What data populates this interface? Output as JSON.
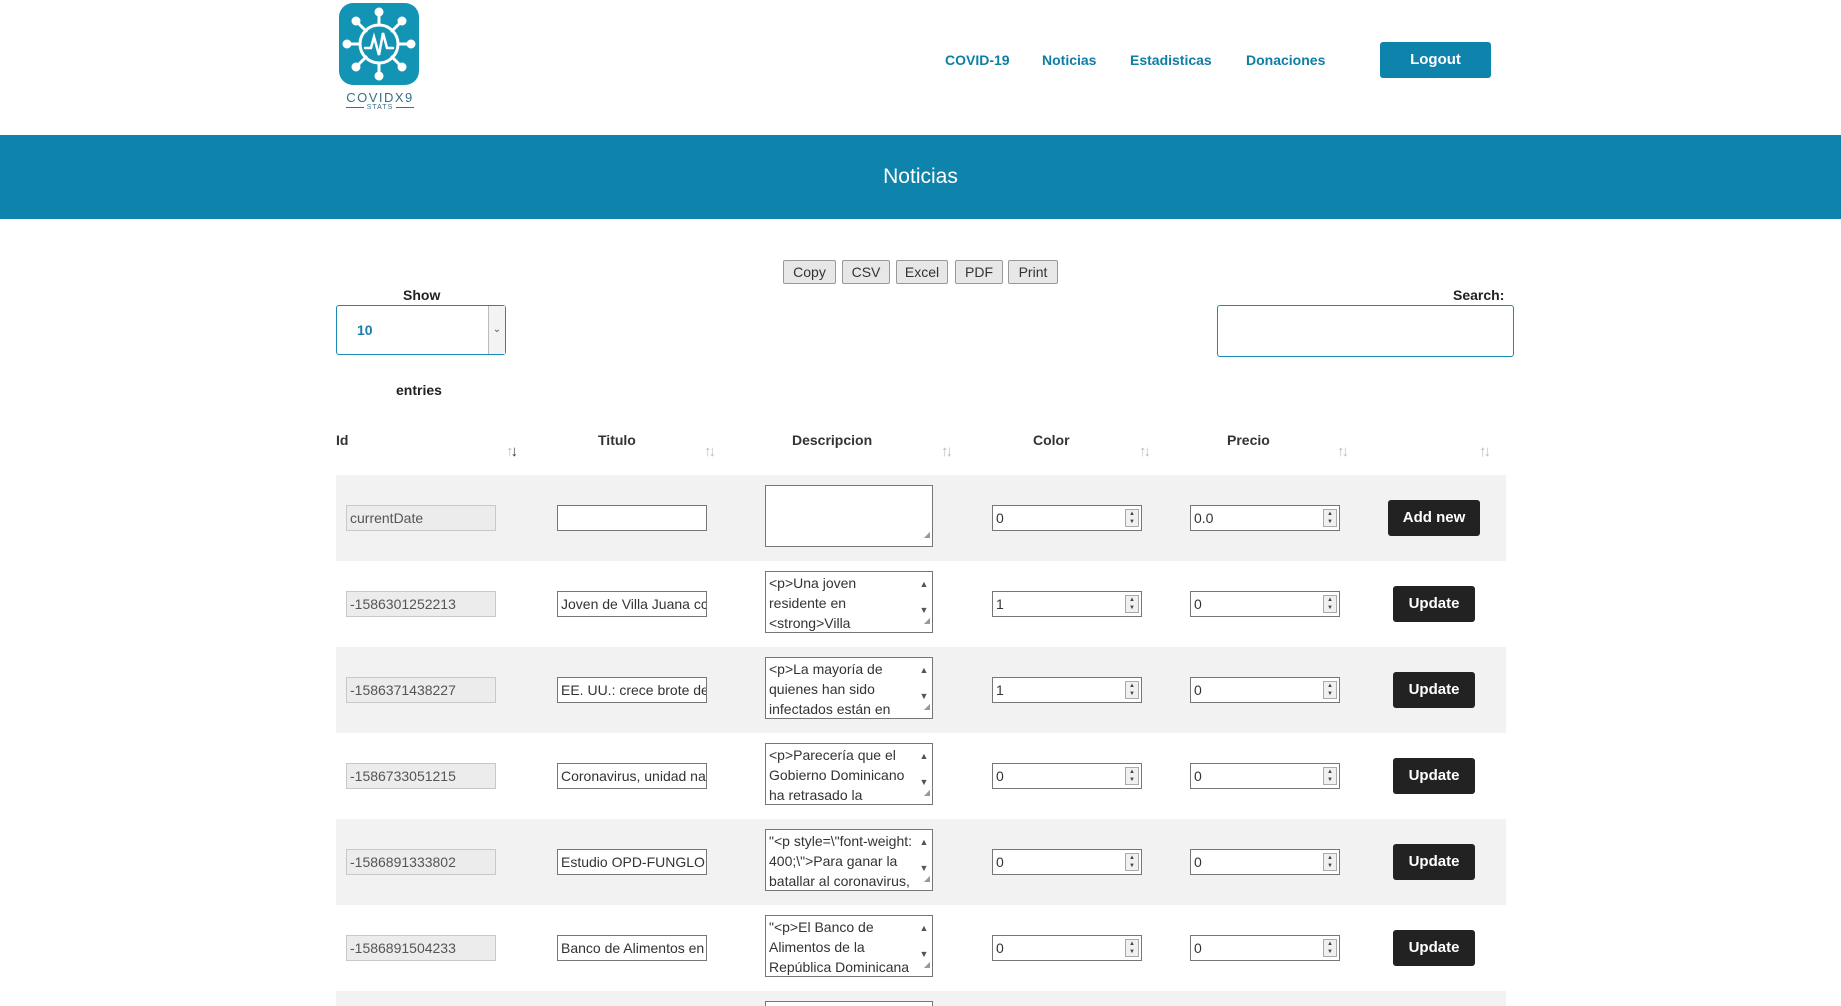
{
  "brand": {
    "name": "COVIDX9",
    "tagline": "STATS"
  },
  "nav": {
    "items": [
      {
        "label": "COVID-19"
      },
      {
        "label": "Noticias"
      },
      {
        "label": "Estadisticas"
      },
      {
        "label": "Donaciones"
      }
    ],
    "logout_label": "Logout"
  },
  "banner": {
    "title": "Noticias"
  },
  "export_buttons": [
    "Copy",
    "CSV",
    "Excel",
    "PDF",
    "Print"
  ],
  "length_menu": {
    "label_before": "Show",
    "selected": "10",
    "label_after": "entries"
  },
  "search": {
    "label": "Search:",
    "value": ""
  },
  "table": {
    "columns": [
      "Id",
      "Titulo",
      "Descripcion",
      "Color",
      "Precio",
      ""
    ],
    "new_row": {
      "id": "currentDate",
      "titulo": "",
      "descripcion": "",
      "color": "0",
      "precio": "0.0",
      "action": "Add new"
    },
    "rows": [
      {
        "id": "-1586301252213",
        "titulo": "Joven de Villa Juana cc",
        "descripcion": "<p>Una joven residente en <strong>Villa",
        "color": "1",
        "precio": "0",
        "action": "Update"
      },
      {
        "id": "-1586371438227",
        "titulo": "EE. UU.: crece brote de",
        "descripcion": "<p>La mayoría de quienes han sido infectados están en",
        "color": "1",
        "precio": "0",
        "action": "Update"
      },
      {
        "id": "-1586733051215",
        "titulo": "Coronavirus, unidad na",
        "descripcion": "<p>Parecería que el Gobierno Dominicano ha retrasado la",
        "color": "0",
        "precio": "0",
        "action": "Update"
      },
      {
        "id": "-1586891333802",
        "titulo": "Estudio OPD-FUNGLO",
        "descripcion": "\"<p style=\\\"font-weight: 400;\\\">Para ganar la batallar al coronavirus,",
        "color": "0",
        "precio": "0",
        "action": "Update"
      },
      {
        "id": "-1586891504233",
        "titulo": "Banco de Alimentos en",
        "descripcion": "\"<p>El Banco de Alimentos de la República Dominicana",
        "color": "0",
        "precio": "0",
        "action": "Update"
      }
    ]
  }
}
